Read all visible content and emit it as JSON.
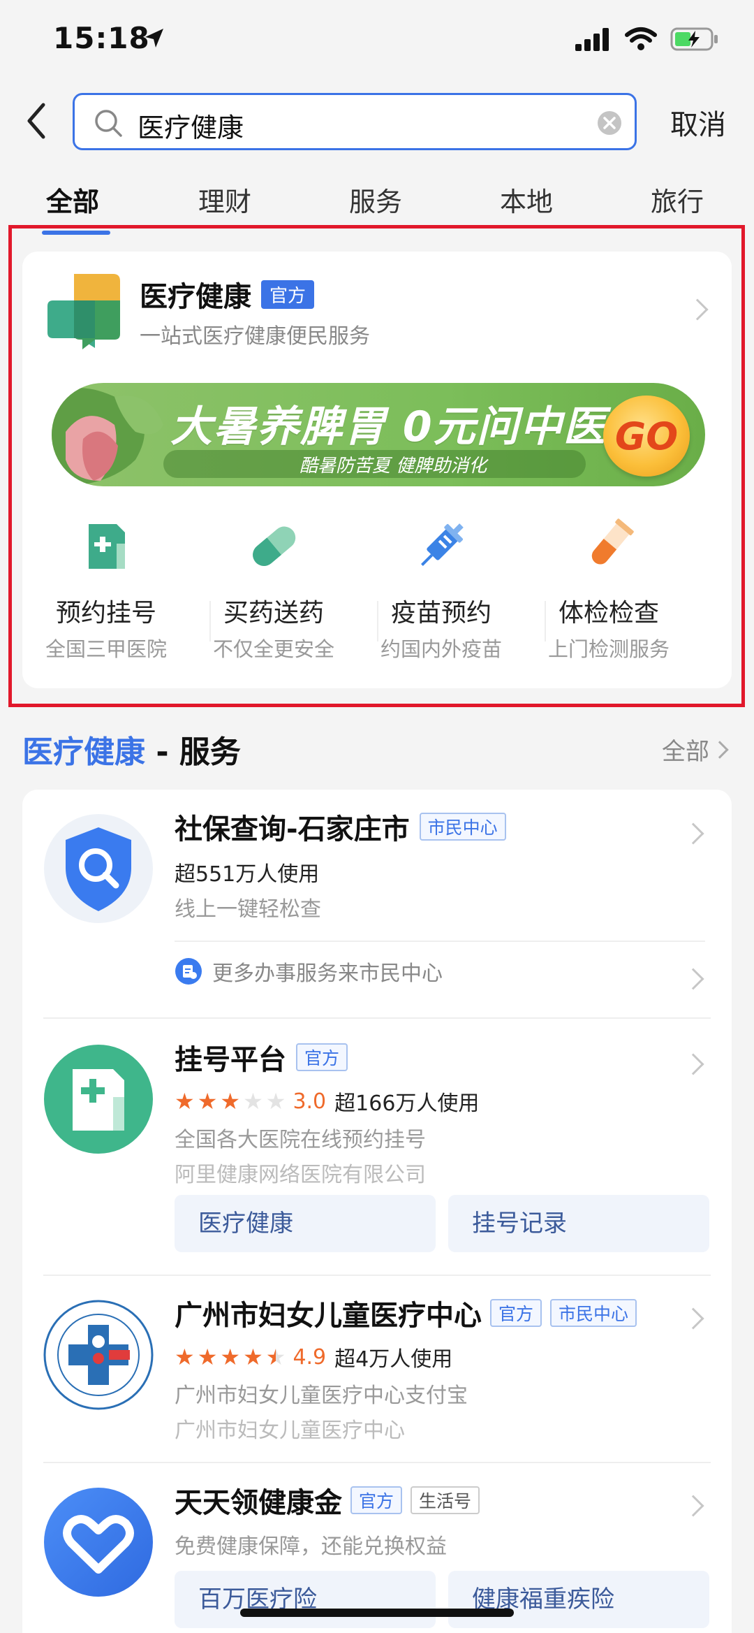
{
  "status": {
    "time": "15:18"
  },
  "search": {
    "value": "医疗健康",
    "cancel": "取消"
  },
  "tabs": [
    "全部",
    "理财",
    "服务",
    "本地",
    "旅行"
  ],
  "main_app": {
    "name": "医疗健康",
    "badge": "官方",
    "subtitle": "一站式医疗健康便民服务",
    "banner": {
      "title": "大暑养脾胃 0元问中医",
      "subtitle": "酷暑防苦夏 健脾助消化",
      "go": "GO"
    },
    "features": [
      {
        "label": "预约挂号",
        "sub": "全国三甲医院",
        "icon": "hospital-card-icon"
      },
      {
        "label": "买药送药",
        "sub": "不仅全更安全",
        "icon": "pill-icon"
      },
      {
        "label": "疫苗预约",
        "sub": "约国内外疫苗",
        "icon": "syringe-icon"
      },
      {
        "label": "体检检查",
        "sub": "上门检测服务",
        "icon": "test-tube-icon"
      }
    ]
  },
  "section": {
    "highlight": "医疗健康",
    "rest": " - 服务",
    "all": "全部"
  },
  "services": [
    {
      "title": "社保查询-石家庄市",
      "tags": [
        "市民中心"
      ],
      "users": "超551万人使用",
      "desc": "线上一键轻松查",
      "more": "更多办事服务来市民中心"
    },
    {
      "title": "挂号平台",
      "tags": [
        "官方"
      ],
      "rating": "3.0",
      "stars": 3,
      "users": "超166万人使用",
      "desc": "全国各大医院在线预约挂号",
      "company": "阿里健康网络医院有限公司",
      "actions": [
        "医疗健康",
        "挂号记录"
      ]
    },
    {
      "title": "广州市妇女儿童医疗中心",
      "tags": [
        "官方",
        "市民中心"
      ],
      "rating": "4.9",
      "stars": 4.5,
      "users": "超4万人使用",
      "desc": "广州市妇女儿童医疗中心支付宝",
      "company": "广州市妇女儿童医疗中心"
    },
    {
      "title": "天天领健康金",
      "tags": [
        "官方",
        "生活号"
      ],
      "desc": "免费健康保障，还能兑换权益",
      "actions": [
        "百万医疗险",
        "健康福重疾险"
      ]
    }
  ],
  "colors": {
    "accent": "#3b73e6",
    "highlight_frame": "#e1182b",
    "star": "#ef6a2b"
  }
}
